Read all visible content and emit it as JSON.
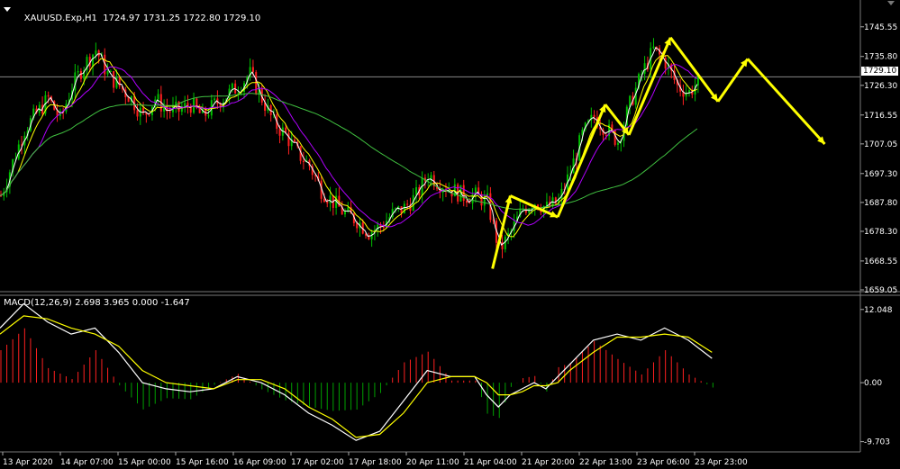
{
  "window": {
    "symbol_header": "XAUUSD.Exp,H1",
    "ohlc": "1724.97 1731.25 1722.80 1729.10",
    "macd_header": "MACD(12,26,9) 2.698 3.965 0.000 -1.647"
  },
  "colors": {
    "background": "#000000",
    "bull": "#00c000",
    "bear": "#ff2020",
    "ma_fast": "#ffffff",
    "ma_mid": "#ffff00",
    "ma_slow": "#b000ff",
    "ma_long": "#40c040",
    "arrows": "#ffff00",
    "macd_line": "#ffffff",
    "signal_line": "#ffff00",
    "hist_pos": "#ff2020",
    "hist_neg": "#00a000"
  },
  "chart_data": [
    {
      "type": "candlestick",
      "title": "XAUUSD.Exp,H1",
      "ylim": [
        1659.05,
        1752.0
      ],
      "yticks": [
        "1745.55",
        "1735.80",
        "1726.30",
        "1716.55",
        "1707.05",
        "1697.30",
        "1687.80",
        "1678.30",
        "1668.55",
        "1659.05"
      ],
      "current_price": "1729.10",
      "xticks": [
        "13 Apr 2020",
        "14 Apr 07:00",
        "15 Apr 00:00",
        "15 Apr 16:00",
        "16 Apr 09:00",
        "17 Apr 02:00",
        "17 Apr 18:00",
        "20 Apr 11:00",
        "21 Apr 04:00",
        "21 Apr 20:00",
        "22 Apr 13:00",
        "23 Apr 06:00",
        "23 Apr 23:00"
      ],
      "price_path": [
        [
          0,
          1690
        ],
        [
          4,
          1712
        ],
        [
          8,
          1722
        ],
        [
          10,
          1715
        ],
        [
          12,
          1726
        ],
        [
          14,
          1733
        ],
        [
          16,
          1738
        ],
        [
          18,
          1730
        ],
        [
          20,
          1726
        ],
        [
          22,
          1722
        ],
        [
          24,
          1716
        ],
        [
          26,
          1722
        ],
        [
          28,
          1718
        ],
        [
          30,
          1718
        ],
        [
          32,
          1720
        ],
        [
          34,
          1716
        ],
        [
          36,
          1720
        ],
        [
          38,
          1723
        ],
        [
          40,
          1726
        ],
        [
          42,
          1730
        ],
        [
          44,
          1722
        ],
        [
          46,
          1714
        ],
        [
          48,
          1710
        ],
        [
          50,
          1704
        ],
        [
          52,
          1700
        ],
        [
          54,
          1692
        ],
        [
          56,
          1688
        ],
        [
          58,
          1684
        ],
        [
          60,
          1682
        ],
        [
          62,
          1678
        ],
        [
          64,
          1680
        ],
        [
          66,
          1684
        ],
        [
          68,
          1686
        ],
        [
          70,
          1690
        ],
        [
          72,
          1697
        ],
        [
          74,
          1694
        ],
        [
          76,
          1692
        ],
        [
          78,
          1690
        ],
        [
          80,
          1690
        ],
        [
          82,
          1688
        ],
        [
          84,
          1672
        ],
        [
          86,
          1678
        ],
        [
          88,
          1686
        ],
        [
          90,
          1688
        ],
        [
          92,
          1686
        ],
        [
          94,
          1688
        ],
        [
          96,
          1698
        ],
        [
          98,
          1710
        ],
        [
          100,
          1716
        ],
        [
          102,
          1712
        ],
        [
          104,
          1708
        ],
        [
          106,
          1720
        ],
        [
          108,
          1730
        ],
        [
          110,
          1738
        ],
        [
          112,
          1734
        ],
        [
          114,
          1726
        ],
        [
          116,
          1724
        ],
        [
          118,
          1729
        ]
      ],
      "series": [
        {
          "name": "",
          "color_key": "ma_fast"
        },
        {
          "name": "",
          "color_key": "ma_mid"
        },
        {
          "name": "",
          "color_key": "ma_slow"
        },
        {
          "name": "",
          "color_key": "ma_long"
        }
      ],
      "annotation_arrows": [
        [
          [
            83,
            1666
          ],
          [
            86,
            1690
          ]
        ],
        [
          [
            86,
            1690
          ],
          [
            94,
            1683
          ]
        ],
        [
          [
            94,
            1683
          ],
          [
            102,
            1720
          ]
        ],
        [
          [
            102,
            1720
          ],
          [
            106,
            1710
          ]
        ],
        [
          [
            106,
            1710
          ],
          [
            113,
            1742
          ]
        ],
        [
          [
            113,
            1742
          ],
          [
            121,
            1721
          ]
        ],
        [
          [
            121,
            1721
          ],
          [
            126,
            1735
          ]
        ],
        [
          [
            126,
            1735
          ],
          [
            139,
            1707
          ]
        ]
      ]
    },
    {
      "type": "macd",
      "title": "MACD(12,26,9)",
      "ylim": [
        -10.5,
        13.2
      ],
      "yticks": [
        "12.048",
        "0.00",
        "-9.703"
      ],
      "macd_path": [
        [
          0,
          9
        ],
        [
          4,
          13
        ],
        [
          8,
          10
        ],
        [
          12,
          8
        ],
        [
          16,
          9
        ],
        [
          20,
          5
        ],
        [
          24,
          0
        ],
        [
          28,
          -1
        ],
        [
          32,
          -1.5
        ],
        [
          36,
          -1
        ],
        [
          40,
          1
        ],
        [
          44,
          0
        ],
        [
          48,
          -2
        ],
        [
          52,
          -5
        ],
        [
          56,
          -7
        ],
        [
          60,
          -9.5
        ],
        [
          64,
          -8
        ],
        [
          68,
          -3
        ],
        [
          72,
          2
        ],
        [
          76,
          1
        ],
        [
          80,
          1
        ],
        [
          82,
          -2
        ],
        [
          84,
          -4
        ],
        [
          86,
          -2
        ],
        [
          88,
          -1
        ],
        [
          90,
          0
        ],
        [
          92,
          -1
        ],
        [
          94,
          1
        ],
        [
          96,
          3
        ],
        [
          100,
          7
        ],
        [
          104,
          8
        ],
        [
          108,
          7
        ],
        [
          112,
          9
        ],
        [
          116,
          7
        ],
        [
          120,
          4
        ]
      ],
      "signal_path": [
        [
          0,
          8
        ],
        [
          4,
          11
        ],
        [
          8,
          10.5
        ],
        [
          12,
          9
        ],
        [
          16,
          8
        ],
        [
          20,
          6
        ],
        [
          24,
          2
        ],
        [
          28,
          0
        ],
        [
          32,
          -0.5
        ],
        [
          36,
          -1
        ],
        [
          40,
          0.5
        ],
        [
          44,
          0.5
        ],
        [
          48,
          -1
        ],
        [
          52,
          -4
        ],
        [
          56,
          -6
        ],
        [
          60,
          -9
        ],
        [
          64,
          -8.5
        ],
        [
          68,
          -5
        ],
        [
          72,
          0
        ],
        [
          76,
          1
        ],
        [
          80,
          1
        ],
        [
          82,
          0
        ],
        [
          84,
          -2
        ],
        [
          86,
          -2
        ],
        [
          88,
          -1.5
        ],
        [
          90,
          -0.5
        ],
        [
          92,
          -0.5
        ],
        [
          94,
          0
        ],
        [
          96,
          2
        ],
        [
          100,
          5
        ],
        [
          104,
          7.5
        ],
        [
          108,
          7.5
        ],
        [
          112,
          8
        ],
        [
          116,
          7.5
        ],
        [
          120,
          5
        ]
      ]
    }
  ]
}
